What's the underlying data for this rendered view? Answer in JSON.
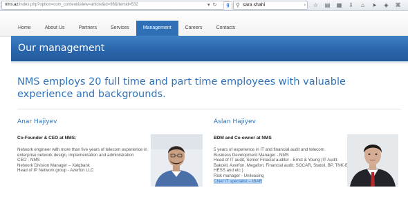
{
  "browser": {
    "url_domain": "nms.az",
    "url_path": "/index.php?option=com_content&view=article&id=96&Itemid=532",
    "search_value": "sara shahi"
  },
  "nav": {
    "items": [
      {
        "label": "Home"
      },
      {
        "label": "About Us"
      },
      {
        "label": "Partners"
      },
      {
        "label": "Services"
      },
      {
        "label": "Management"
      },
      {
        "label": "Careers"
      },
      {
        "label": "Contacts"
      }
    ],
    "active_index": 4
  },
  "page": {
    "title": "Our management",
    "intro": "NMS employs 20 full time and part time employees with valuable experience and backgrounds."
  },
  "people": [
    {
      "name": "Anar Hajiyev",
      "role": "Co-Founder & CEO at NMS:",
      "bio": [
        "Network engineer with more than five years of telecom experience in",
        "enterprise network design, implementation and administration",
        "CEO - NMS",
        "Network Division Manager – Xalqbank",
        "Head of IP Network group - Azerfon LLC"
      ]
    },
    {
      "name": "Aslan Hajiyev",
      "role": "BDM and Co-owner at NMS",
      "bio": [
        "5 years of experience in IT and financial audit and telecom",
        "Business Development Manager - NMS",
        "Head of IT audit, Senior Finacial auditor - Ernst & Young (IT Audit:",
        "Bakcell, Azerfon, Megafon; Financial audit: SOCAR, Statoil, BP, TNK-BP,",
        "HESS and etc.)",
        "Risk manager - Unileasing"
      ],
      "bio_highlighted": "Chief IT specialist – IBAR"
    }
  ],
  "colors": {
    "accent": "#2e74bd",
    "nav_active": "#2f6fb5",
    "hero": "#2a66ad"
  }
}
